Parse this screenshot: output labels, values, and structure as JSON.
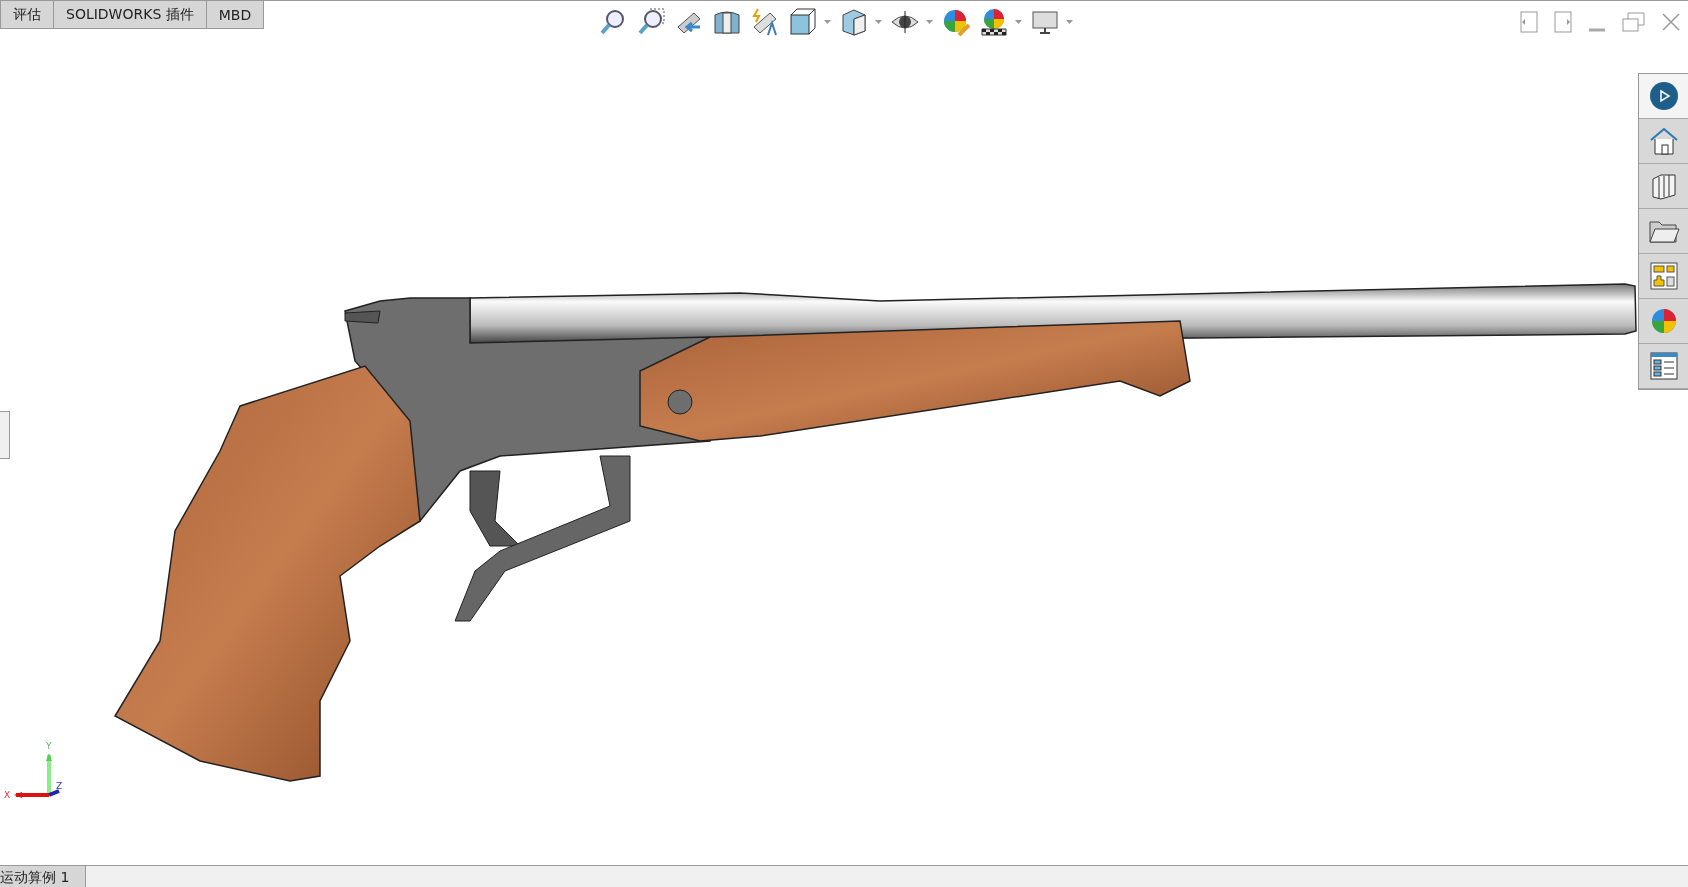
{
  "command_tabs": [
    {
      "label": "评估"
    },
    {
      "label": "SOLIDWORKS 插件"
    },
    {
      "label": "MBD"
    }
  ],
  "triad": {
    "x_label": "X",
    "y_label": "Y",
    "z_label": "Z"
  },
  "bottom_tabs": [
    {
      "label": "运动算例 1"
    }
  ]
}
